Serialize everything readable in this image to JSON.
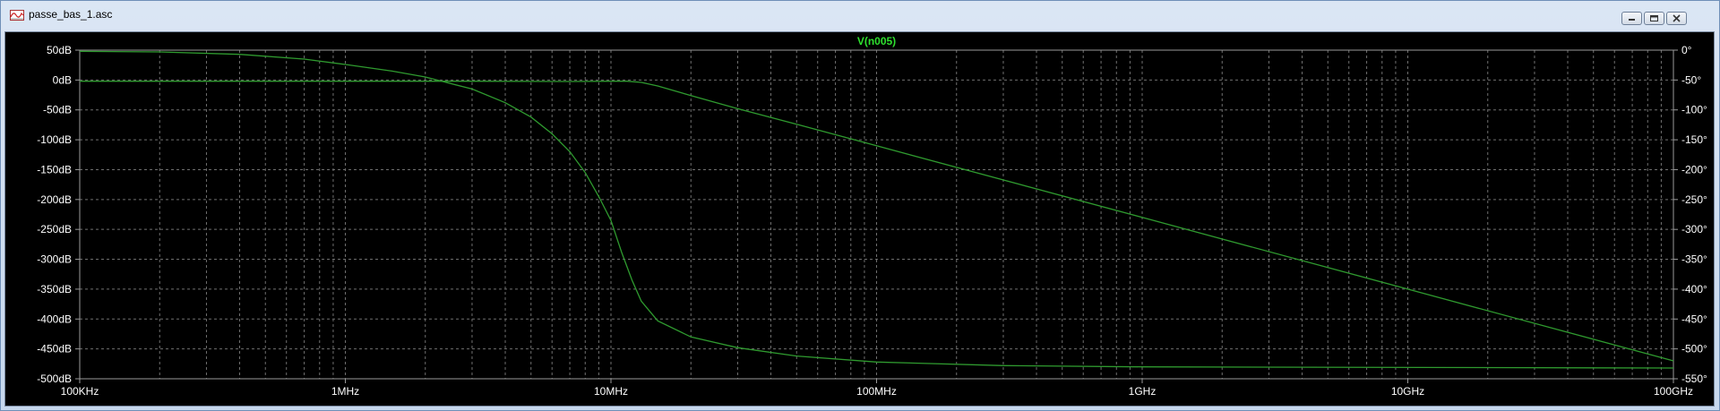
{
  "window": {
    "title": "passe_bas_1.asc",
    "app_icon": "ltspice-waveform-icon",
    "buttons": {
      "minimize": "minimize-icon",
      "maximize": "maximize-icon",
      "close": "close-icon"
    }
  },
  "colors": {
    "background": "#000000",
    "axis": "#9a9a9a",
    "grid": "#6f6f6f",
    "label_text": "#ffffff",
    "trace_magnitude": "#2f9a2f",
    "trace_phase": "#2f9a2f",
    "trace_title": "#2ee02e"
  },
  "chart_data": {
    "type": "line",
    "title": "V(n005)",
    "x_scale": "log",
    "xlim_hz": [
      100000,
      100000000000
    ],
    "x_ticks": [
      {
        "value_hz": 100000,
        "label": "100KHz"
      },
      {
        "value_hz": 1000000,
        "label": "1MHz"
      },
      {
        "value_hz": 10000000,
        "label": "10MHz"
      },
      {
        "value_hz": 100000000,
        "label": "100MHz"
      },
      {
        "value_hz": 1000000000,
        "label": "1GHz"
      },
      {
        "value_hz": 10000000000,
        "label": "10GHz"
      },
      {
        "value_hz": 100000000000,
        "label": "100GHz"
      }
    ],
    "left_axis": {
      "unit": "dB",
      "ylim": [
        -500,
        50
      ],
      "ticks": [
        {
          "value": 50,
          "label": "50dB"
        },
        {
          "value": 0,
          "label": "0dB"
        },
        {
          "value": -50,
          "label": "-50dB"
        },
        {
          "value": -100,
          "label": "-100dB"
        },
        {
          "value": -150,
          "label": "-150dB"
        },
        {
          "value": -200,
          "label": "-200dB"
        },
        {
          "value": -250,
          "label": "-250dB"
        },
        {
          "value": -300,
          "label": "-300dB"
        },
        {
          "value": -350,
          "label": "-350dB"
        },
        {
          "value": -400,
          "label": "-400dB"
        },
        {
          "value": -450,
          "label": "-450dB"
        },
        {
          "value": -500,
          "label": "-500dB"
        }
      ]
    },
    "right_axis": {
      "unit": "°",
      "ylim": [
        -550,
        0
      ],
      "ticks": [
        {
          "value": 0,
          "label": "0°"
        },
        {
          "value": -50,
          "label": "-50°"
        },
        {
          "value": -100,
          "label": "-100°"
        },
        {
          "value": -150,
          "label": "-150°"
        },
        {
          "value": -200,
          "label": "-200°"
        },
        {
          "value": -250,
          "label": "-250°"
        },
        {
          "value": -300,
          "label": "-300°"
        },
        {
          "value": -350,
          "label": "-350°"
        },
        {
          "value": -400,
          "label": "-400°"
        },
        {
          "value": -450,
          "label": "-450°"
        },
        {
          "value": -500,
          "label": "-500°"
        },
        {
          "value": -550,
          "label": "-550°"
        }
      ]
    },
    "grid": true,
    "series": [
      {
        "axis": "left",
        "points": [
          [
            100000,
            -2
          ],
          [
            1000000,
            -2
          ],
          [
            3000000,
            -2
          ],
          [
            7000000,
            -2.5
          ],
          [
            10000000,
            -2
          ],
          [
            11500000,
            -2
          ],
          [
            13000000,
            -4
          ],
          [
            15000000,
            -10
          ],
          [
            20000000,
            -26
          ],
          [
            30000000,
            -48
          ],
          [
            50000000,
            -74
          ],
          [
            100000000,
            -110
          ],
          [
            1000000000,
            -230
          ],
          [
            10000000000,
            -350
          ],
          [
            100000000000,
            -470
          ]
        ]
      },
      {
        "axis": "right",
        "points": [
          [
            100000,
            -2
          ],
          [
            200000,
            -3
          ],
          [
            400000,
            -7
          ],
          [
            700000,
            -15
          ],
          [
            1000000,
            -24
          ],
          [
            1500000,
            -35
          ],
          [
            2000000,
            -45
          ],
          [
            3000000,
            -65
          ],
          [
            4000000,
            -88
          ],
          [
            5000000,
            -112
          ],
          [
            6000000,
            -140
          ],
          [
            7000000,
            -170
          ],
          [
            8000000,
            -205
          ],
          [
            9000000,
            -245
          ],
          [
            10000000,
            -285
          ],
          [
            11000000,
            -340
          ],
          [
            12000000,
            -385
          ],
          [
            13000000,
            -420
          ],
          [
            15000000,
            -453
          ],
          [
            20000000,
            -480
          ],
          [
            30000000,
            -498
          ],
          [
            50000000,
            -512
          ],
          [
            100000000,
            -522
          ],
          [
            300000000,
            -528
          ],
          [
            1000000000,
            -530
          ],
          [
            100000000000,
            -532
          ]
        ]
      }
    ]
  }
}
